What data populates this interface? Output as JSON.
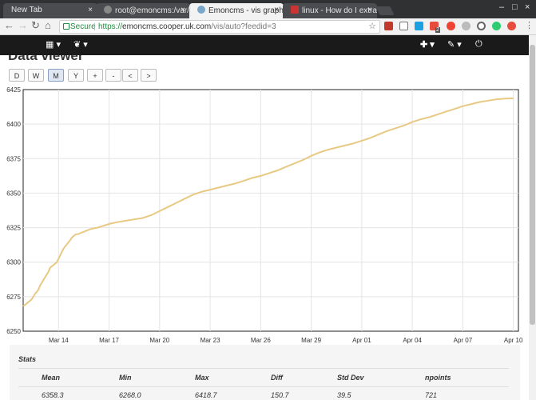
{
  "browser": {
    "tabs": [
      {
        "title": "New Tab",
        "active": false
      },
      {
        "title": "root@emoncms:/var/lo",
        "active": false
      },
      {
        "title": "Emoncms - vis graph",
        "active": true
      },
      {
        "title": "linux - How do I extract l",
        "active": false
      }
    ],
    "url": {
      "secure_label": "Secure",
      "scheme": "https://",
      "host": "emoncms.cooper.uk.com",
      "path": "/vis/auto?feedid=3"
    },
    "extension_badge": "2",
    "close_glyph": "×",
    "win_min": "–",
    "win_max": "□",
    "win_close": "×"
  },
  "appnav": {
    "left_icons": [
      "apps-grid-icon",
      "leaf-icon"
    ],
    "right_icons": [
      "plus-icon",
      "wrench-icon",
      "power-icon"
    ]
  },
  "viewer": {
    "title": "Data viewer",
    "buttons": [
      "D",
      "W",
      "M",
      "Y",
      "+",
      "-",
      "<",
      ">"
    ],
    "active_button": "M"
  },
  "chart_data": {
    "type": "line",
    "y_ticks": [
      "6425",
      "6400",
      "6375",
      "6350",
      "6325",
      "6300",
      "6275",
      "6250"
    ],
    "x_ticks": [
      "Mar 14",
      "Mar 17",
      "Mar 20",
      "Mar 23",
      "Mar 26",
      "Mar 29",
      "Apr 01",
      "Apr 04",
      "Apr 07",
      "Apr 10"
    ],
    "ylim": [
      6250,
      6425
    ],
    "line_color": "#e8c983",
    "grid": true,
    "series": [
      {
        "x": [
          11.9,
          12.0,
          12.2,
          12.4,
          12.5,
          12.6,
          12.8,
          12.9,
          13.0,
          13.1,
          13.2,
          13.4,
          13.5,
          13.7,
          13.9,
          14.1,
          14.3,
          14.5,
          14.7,
          14.8,
          15.0,
          15.2,
          15.5,
          15.9,
          16.3,
          16.7,
          17.1,
          17.5,
          18.0,
          18.5,
          19.0,
          19.5,
          20.0,
          20.5,
          21.0,
          21.5,
          22.0,
          22.5,
          23.0,
          23.5,
          24.0,
          24.5,
          25.0,
          25.5,
          26.0,
          26.5,
          27.0,
          27.5,
          28.0,
          28.5,
          29.0,
          29.5,
          30.0,
          30.5,
          31.0,
          31.5,
          32.0,
          32.5,
          33.0,
          33.5,
          34.0,
          34.5,
          35.0,
          35.5,
          36.0,
          36.5,
          37.0,
          37.5,
          38.0,
          38.5,
          39.0,
          39.5,
          40.0,
          40.5,
          41.0
        ],
        "values": [
          6268.0,
          6269.0,
          6271.0,
          6273.0,
          6275.0,
          6277.0,
          6280.0,
          6283.0,
          6285.0,
          6287.0,
          6289.0,
          6293.0,
          6296.0,
          6298.0,
          6300.0,
          6305.0,
          6310.0,
          6313.0,
          6316.0,
          6318.0,
          6320.0,
          6320.5,
          6322.0,
          6324.0,
          6325.0,
          6326.5,
          6328.0,
          6329.0,
          6330.0,
          6331.0,
          6332.0,
          6334.0,
          6337.0,
          6340.0,
          6343.0,
          6346.0,
          6349.0,
          6351.0,
          6352.5,
          6354.0,
          6355.5,
          6357.0,
          6359.0,
          6361.0,
          6362.5,
          6364.5,
          6366.5,
          6369.0,
          6371.5,
          6374.0,
          6377.0,
          6379.5,
          6381.5,
          6383.0,
          6384.5,
          6386.0,
          6388.0,
          6390.0,
          6392.5,
          6395.0,
          6397.0,
          6399.0,
          6401.5,
          6403.5,
          6405.0,
          6407.0,
          6409.0,
          6411.0,
          6413.0,
          6414.5,
          6416.0,
          6417.0,
          6418.0,
          6418.5,
          6418.7
        ]
      }
    ],
    "x_tick_positions": [
      14,
      17,
      20,
      23,
      26,
      29,
      32,
      35,
      38,
      41
    ],
    "xlim": [
      11.9,
      41.3
    ]
  },
  "stats": {
    "title": "Stats",
    "headers": [
      "Mean",
      "Min",
      "Max",
      "Diff",
      "Std Dev",
      "npoints"
    ],
    "values": [
      "6358.3",
      "6268.0",
      "6418.7",
      "150.7",
      "39.5",
      "721"
    ]
  }
}
